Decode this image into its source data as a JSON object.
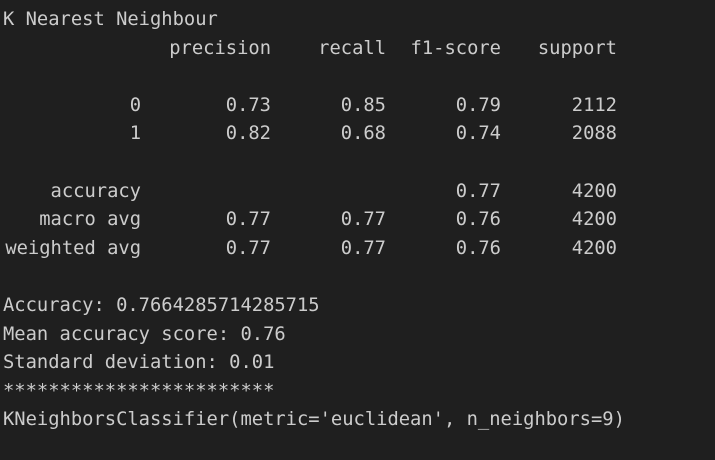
{
  "title": "K Nearest Neighbour",
  "report": {
    "headers": [
      "",
      "precision",
      "recall",
      "f1-score",
      "support"
    ],
    "classes": [
      [
        "0",
        "0.73",
        "0.85",
        "0.79",
        "2112"
      ],
      [
        "1",
        "0.82",
        "0.68",
        "0.74",
        "2088"
      ]
    ],
    "summary": [
      [
        "accuracy",
        "",
        "",
        "0.77",
        "4200"
      ],
      [
        "macro avg",
        "0.77",
        "0.77",
        "0.76",
        "4200"
      ],
      [
        "weighted avg",
        "0.77",
        "0.77",
        "0.76",
        "4200"
      ]
    ]
  },
  "metrics": {
    "accuracy_line": "Accuracy: 0.7664285714285715",
    "mean_line": "Mean accuracy score: 0.76",
    "std_line": "Standard deviation: 0.01",
    "separator": "************************",
    "model_line": "KNeighborsClassifier(metric='euclidean', n_neighbors=9)"
  }
}
